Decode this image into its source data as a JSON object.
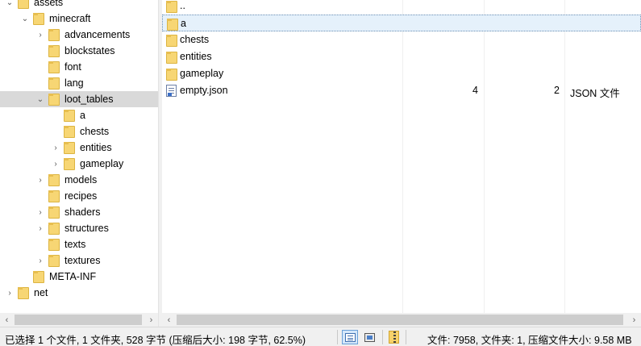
{
  "tree": {
    "items": [
      {
        "label": "assets",
        "chevron": "expanded"
      },
      {
        "label": "minecraft",
        "chevron": "expanded"
      },
      {
        "label": "advancements",
        "chevron": "collapsed"
      },
      {
        "label": "blockstates",
        "chevron": "none"
      },
      {
        "label": "font",
        "chevron": "none"
      },
      {
        "label": "lang",
        "chevron": "none"
      },
      {
        "label": "loot_tables",
        "chevron": "expanded",
        "selected": true
      },
      {
        "label": "a",
        "chevron": "none"
      },
      {
        "label": "chests",
        "chevron": "none"
      },
      {
        "label": "entities",
        "chevron": "collapsed"
      },
      {
        "label": "gameplay",
        "chevron": "collapsed"
      },
      {
        "label": "models",
        "chevron": "collapsed"
      },
      {
        "label": "recipes",
        "chevron": "none"
      },
      {
        "label": "shaders",
        "chevron": "collapsed"
      },
      {
        "label": "structures",
        "chevron": "collapsed"
      },
      {
        "label": "texts",
        "chevron": "none"
      },
      {
        "label": "textures",
        "chevron": "collapsed"
      },
      {
        "label": "META-INF",
        "chevron": "none"
      },
      {
        "label": "net",
        "chevron": "collapsed"
      }
    ]
  },
  "list": {
    "rows": [
      {
        "name": "..",
        "icon": "folder-icon",
        "size": "",
        "packed": "",
        "type": ""
      },
      {
        "name": "a",
        "icon": "folder-icon",
        "size": "",
        "packed": "",
        "type": "",
        "focused": true
      },
      {
        "name": "chests",
        "icon": "folder-icon",
        "size": "",
        "packed": "",
        "type": ""
      },
      {
        "name": "entities",
        "icon": "folder-icon",
        "size": "",
        "packed": "",
        "type": ""
      },
      {
        "name": "gameplay",
        "icon": "folder-icon",
        "size": "",
        "packed": "",
        "type": ""
      },
      {
        "name": "empty.json",
        "icon": "json-file-icon",
        "size": "4",
        "packed": "2",
        "type": "JSON 文件"
      }
    ]
  },
  "scroll": {
    "left": "‹",
    "right": "›"
  },
  "statusbar": {
    "selection": "已选择 1 个文件, 1 文件夹, 528 字节 (压缩后大小: 198 字节, 62.5%)",
    "totals": "文件: 7958, 文件夹: 1, 压缩文件大小: 9.58 MB"
  }
}
